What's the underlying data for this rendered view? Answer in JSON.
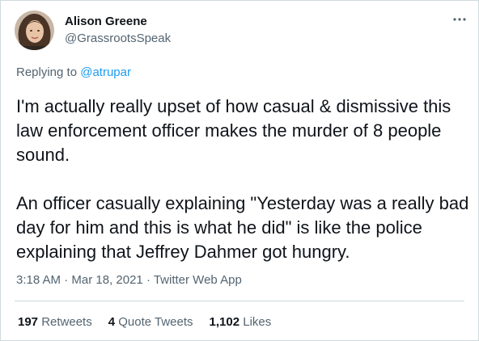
{
  "author": {
    "name": "Alison Greene",
    "handle": "@GrassrootsSpeak"
  },
  "more_icon": "more-horizontal-icon",
  "reply": {
    "prefix": "Replying to ",
    "to": "@atrupar"
  },
  "tweet": {
    "text": "I'm actually really upset of how casual & dismissive this law enforcement officer makes the murder of 8 people sound.\n\nAn officer casually explaining \"Yesterday was a really bad day for him and this is what he did\" is like the police explaining that Jeffrey Dahmer got hungry."
  },
  "meta": {
    "time": "3:18 AM",
    "sep1": " · ",
    "date": "Mar 18, 2021",
    "sep2": " · ",
    "source": "Twitter Web App"
  },
  "stats": {
    "retweets_count": "197",
    "retweets_label": " Retweets",
    "quotes_count": "4",
    "quotes_label": " Quote Tweets",
    "likes_count": "1,102",
    "likes_label": " Likes"
  },
  "colors": {
    "link": "#1d9bf0",
    "secondary": "#536471",
    "text": "#0f1419"
  }
}
